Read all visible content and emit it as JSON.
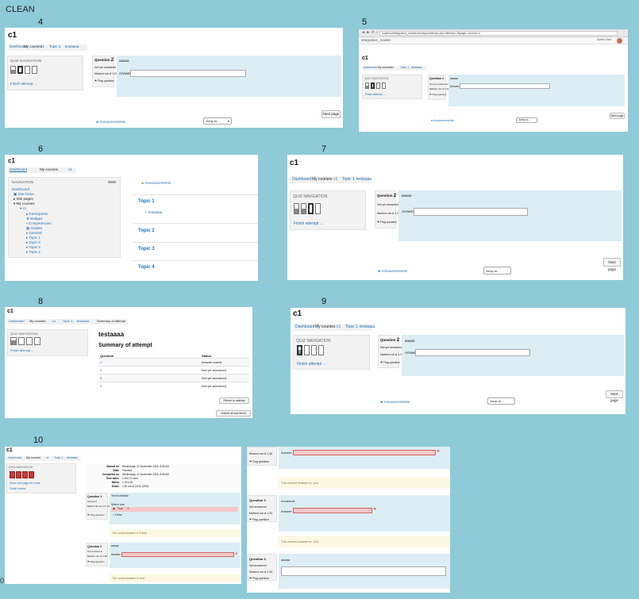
{
  "title": "CLEAN",
  "course": "c1",
  "labels": {
    "s4": "4",
    "s5": "5",
    "s6": "6",
    "s7": "7",
    "s8": "8",
    "s9": "9",
    "s10": "10"
  },
  "breadcrumb": {
    "dashboard": "Dashboard",
    "mycourses": "My courses",
    "course": "c1",
    "topic": "Topic 1",
    "quiz": "testaaaa",
    "summary": "Summary of attempt"
  },
  "quiz_nav": {
    "title": "QUIZ NAVIGATION",
    "finish": "Finish attempt ...",
    "show_one": "Show one page at a time",
    "finish_review": "Finish review",
    "buttons": [
      "1",
      "2",
      "3",
      "4"
    ]
  },
  "question2": {
    "label": "Question",
    "num": "2",
    "status": "Not yet answered",
    "marked": "Marked out of 1.00",
    "flag": "Flag question",
    "text": "aaaaa",
    "answer_label": "Answer:"
  },
  "footer": {
    "next": "Next page",
    "jump": "Jump to...",
    "announcements": "◄ Announcements"
  },
  "browser": {
    "url": "localhost/integration_master/mod/quiz/attempt.php?attempt=1&page=1&cmid=4",
    "site": "integration_master",
    "user": "Admin User"
  },
  "s6": {
    "nav_title": "NAVIGATION",
    "nav_items": [
      "Dashboard",
      "Site home",
      "Site pages",
      "My courses",
      "c1",
      "Participants",
      "Badges",
      "Competencies",
      "Grades",
      "General",
      "Topic 1",
      "Topic 2",
      "Topic 3",
      "Topic 4"
    ],
    "announcements": "Announcements",
    "topics": [
      "Topic 1",
      "Topic 2",
      "Topic 3",
      "Topic 4"
    ],
    "quiz_link": "testaaaa"
  },
  "s8": {
    "quiz_title": "testaaaa",
    "summary_title": "Summary of attempt",
    "col_q": "Question",
    "col_s": "Status",
    "rows": [
      {
        "q": "1",
        "s": "Answer saved"
      },
      {
        "q": "2",
        "s": "Not yet answered"
      },
      {
        "q": "3",
        "s": "Not yet answered"
      },
      {
        "q": "4",
        "s": "Not yet answered"
      }
    ],
    "return_btn": "Return to attempt",
    "submit_btn": "Submit all and finish"
  },
  "s10": {
    "review": [
      {
        "k": "Started on",
        "v": "Wednesday, 21 November 2018, 8:05 AM"
      },
      {
        "k": "State",
        "v": "Finished"
      },
      {
        "k": "Completed on",
        "v": "Wednesday, 21 November 2018, 8:06 AM"
      },
      {
        "k": "Time taken",
        "v": "1 min 21 secs"
      },
      {
        "k": "Marks",
        "v": "1.00/4.00"
      },
      {
        "k": "Grade",
        "v": "2.50 out of 10.00 (25%)"
      }
    ],
    "q1": {
      "label": "Question",
      "num": "1",
      "status": "Incorrect",
      "marked": "Mark 0.00 out of 1.00",
      "flag": "Flag question",
      "text": "Text true/false",
      "select": "Select one:",
      "opt_true": "True",
      "opt_false": "False",
      "correct": "The correct answer is 'False'."
    },
    "q2": {
      "label": "Question",
      "num": "2",
      "status": "Not answered",
      "marked": "Marked out of 1.00",
      "flag": "Flag question",
      "text": "aaaaa",
      "answer_label": "Answer:",
      "correct": "The correct answer is: test"
    }
  },
  "s11": {
    "q2_correct": "The correct answer is: test",
    "q3": {
      "label": "Question",
      "num": "3",
      "status": "Not answered",
      "marked": "Marked out of 1.00",
      "flag": "Flag question",
      "text": "numerical",
      "answer_label": "Answer:",
      "correct": "The correct answer is: 100"
    },
    "q4": {
      "label": "Question",
      "num": "4",
      "status": "Not answered",
      "marked": "Marked out of 1.00",
      "flag": "Flag question",
      "text": "aaaaa"
    },
    "marked": "Marked out of 1.00",
    "flag": "Flag question",
    "answer_label": "Answer:"
  },
  "colors": {
    "background": "#8fcad8",
    "link": "#1f6fb2",
    "question_bg": "#dcedf4",
    "info_bg": "#f2f2f2",
    "incorrect": "#c63b3b",
    "feedback": "#fcf8e3"
  }
}
